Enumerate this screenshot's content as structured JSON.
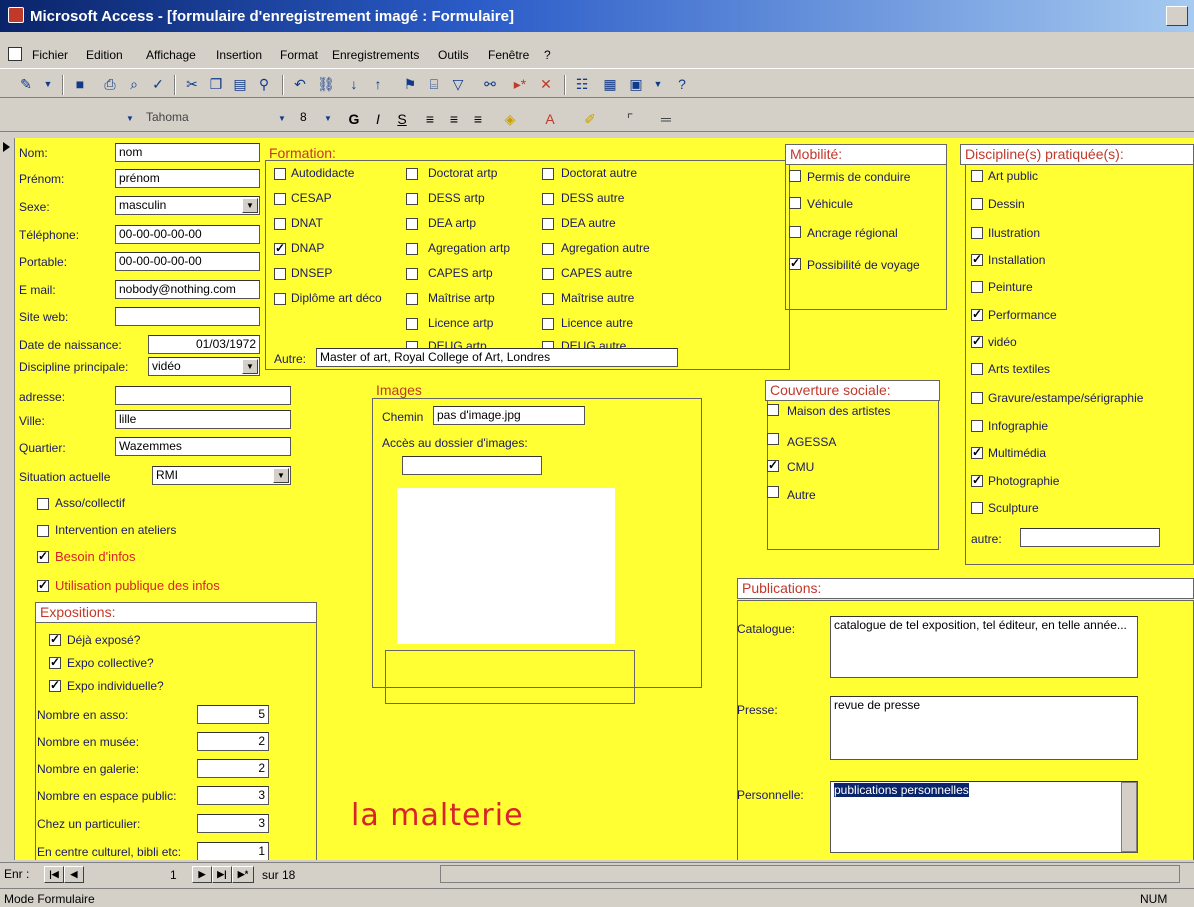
{
  "window": {
    "title": "Microsoft Access - [formulaire d'enregistrement imagé : Formulaire]"
  },
  "menu": [
    "Fichier",
    "Edition",
    "Affichage",
    "Insertion",
    "Format",
    "Enregistrements",
    "Outils",
    "Fenêtre",
    "?"
  ],
  "format_bar": {
    "font": "Tahoma",
    "size": "8"
  },
  "identity": {
    "nom": {
      "label": "Nom:",
      "value": "nom"
    },
    "prenom": {
      "label": "Prénom:",
      "value": "prénom"
    },
    "sexe": {
      "label": "Sexe:",
      "value": "masculin"
    },
    "telephone": {
      "label": "Téléphone:",
      "value": "00-00-00-00-00"
    },
    "portable": {
      "label": "Portable:",
      "value": "00-00-00-00-00"
    },
    "email": {
      "label": "E mail:",
      "value": "nobody@nothing.com"
    },
    "site": {
      "label": "Site web:",
      "value": ""
    },
    "naissance": {
      "label": "Date de naissance:",
      "value": "01/03/1972"
    },
    "discipline": {
      "label": "Discipline principale:",
      "value": "vidéo"
    },
    "adresse": {
      "label": "adresse:",
      "value": ""
    },
    "ville": {
      "label": "Ville:",
      "value": "lille"
    },
    "quartier": {
      "label": "Quartier:",
      "value": "Wazemmes"
    },
    "situation": {
      "label": "Situation actuelle",
      "value": "RMI"
    },
    "checks": [
      {
        "label": "Asso/collectif",
        "checked": false,
        "red": false
      },
      {
        "label": "Intervention en ateliers",
        "checked": false,
        "red": false
      },
      {
        "label": "Besoin d'infos",
        "checked": true,
        "red": true
      },
      {
        "label": "Utilisation publique des infos",
        "checked": true,
        "red": true
      }
    ]
  },
  "formation": {
    "title": "Formation:",
    "col1": [
      {
        "label": "Autodidacte",
        "checked": false
      },
      {
        "label": "CESAP",
        "checked": false
      },
      {
        "label": "DNAT",
        "checked": false
      },
      {
        "label": "DNAP",
        "checked": true
      },
      {
        "label": "DNSEP",
        "checked": false
      },
      {
        "label": "Diplôme art déco",
        "checked": false
      }
    ],
    "col2": [
      {
        "label": "Doctorat artp",
        "checked": false
      },
      {
        "label": "DESS artp",
        "checked": false
      },
      {
        "label": "DEA artp",
        "checked": false
      },
      {
        "label": "Agregation artp",
        "checked": false
      },
      {
        "label": "CAPES artp",
        "checked": false
      },
      {
        "label": "Maîtrise artp",
        "checked": false
      },
      {
        "label": "Licence artp",
        "checked": false
      },
      {
        "label": "DEUG artp",
        "checked": false
      }
    ],
    "col3": [
      {
        "label": "Doctorat autre",
        "checked": false
      },
      {
        "label": "DESS autre",
        "checked": false
      },
      {
        "label": "DEA autre",
        "checked": false
      },
      {
        "label": "Agregation autre",
        "checked": false
      },
      {
        "label": "CAPES autre",
        "checked": false
      },
      {
        "label": "Maîtrise autre",
        "checked": false
      },
      {
        "label": "Licence autre",
        "checked": false
      },
      {
        "label": "DEUG autre",
        "checked": false
      }
    ],
    "autre_label": "Autre:",
    "autre_value": "Master of art, Royal College of Art, Londres"
  },
  "mobilite": {
    "title": "Mobilité:",
    "items": [
      {
        "label": "Permis de conduire",
        "checked": false
      },
      {
        "label": "Véhicule",
        "checked": false
      },
      {
        "label": "Ancrage régional",
        "checked": false
      },
      {
        "label": "Possibilité de voyage",
        "checked": true
      }
    ]
  },
  "disciplines": {
    "title": "Discipline(s) pratiquée(s):",
    "items": [
      {
        "label": "Art public",
        "checked": false
      },
      {
        "label": "Dessin",
        "checked": false
      },
      {
        "label": "Ilustration",
        "checked": false
      },
      {
        "label": "Installation",
        "checked": true
      },
      {
        "label": "Peinture",
        "checked": false
      },
      {
        "label": "Performance",
        "checked": true
      },
      {
        "label": "vidéo",
        "checked": true
      },
      {
        "label": "Arts textiles",
        "checked": false
      },
      {
        "label": "Gravure/estampe/sérigraphie",
        "checked": false
      },
      {
        "label": "Infographie",
        "checked": false
      },
      {
        "label": "Multimédia",
        "checked": true
      },
      {
        "label": "Photographie",
        "checked": true
      },
      {
        "label": "Sculpture",
        "checked": false
      }
    ],
    "autre_label": "autre:",
    "autre_value": ""
  },
  "images": {
    "title": "Images",
    "chemin_label": "Chemin",
    "chemin_value": "pas d'image.jpg",
    "acces_label": "Accès au dossier d'images:",
    "acces_value": ""
  },
  "couverture": {
    "title": "Couverture sociale:",
    "items": [
      {
        "label": "Maison des artistes",
        "checked": false
      },
      {
        "label": "AGESSA",
        "checked": false
      },
      {
        "label": "CMU",
        "checked": true
      },
      {
        "label": "Autre",
        "checked": false
      }
    ]
  },
  "publications": {
    "title": "Publications:",
    "catalogue_label": "Catalogue:",
    "catalogue_value": "catalogue de tel exposition, tel éditeur, en telle année...",
    "presse_label": "Presse:",
    "presse_value": "revue de presse",
    "perso_label": "Personnelle:",
    "perso_value": "publications personnelles"
  },
  "expositions": {
    "title": "Expositions:",
    "checks": [
      {
        "label": "Déjà exposé?",
        "checked": true
      },
      {
        "label": "Expo collective?",
        "checked": true
      },
      {
        "label": "Expo individuelle?",
        "checked": true
      }
    ],
    "counts": [
      {
        "label": "Nombre en asso:",
        "value": "5"
      },
      {
        "label": "Nombre en musée:",
        "value": "2"
      },
      {
        "label": "Nombre en galerie:",
        "value": "2"
      },
      {
        "label": "Nombre en espace public:",
        "value": "3"
      },
      {
        "label": "Chez un particulier:",
        "value": "3"
      },
      {
        "label": "En centre culturel, bibli etc:",
        "value": "1"
      }
    ]
  },
  "logo": "la malterie",
  "navigation": {
    "label": "Enr :",
    "current": "1",
    "total_label": "sur 18"
  },
  "status": {
    "mode": "Mode Formulaire",
    "num": "NUM"
  },
  "colors": {
    "form_bg": "#ffff33",
    "label": "#1a1a66",
    "accent": "#d8232a"
  }
}
